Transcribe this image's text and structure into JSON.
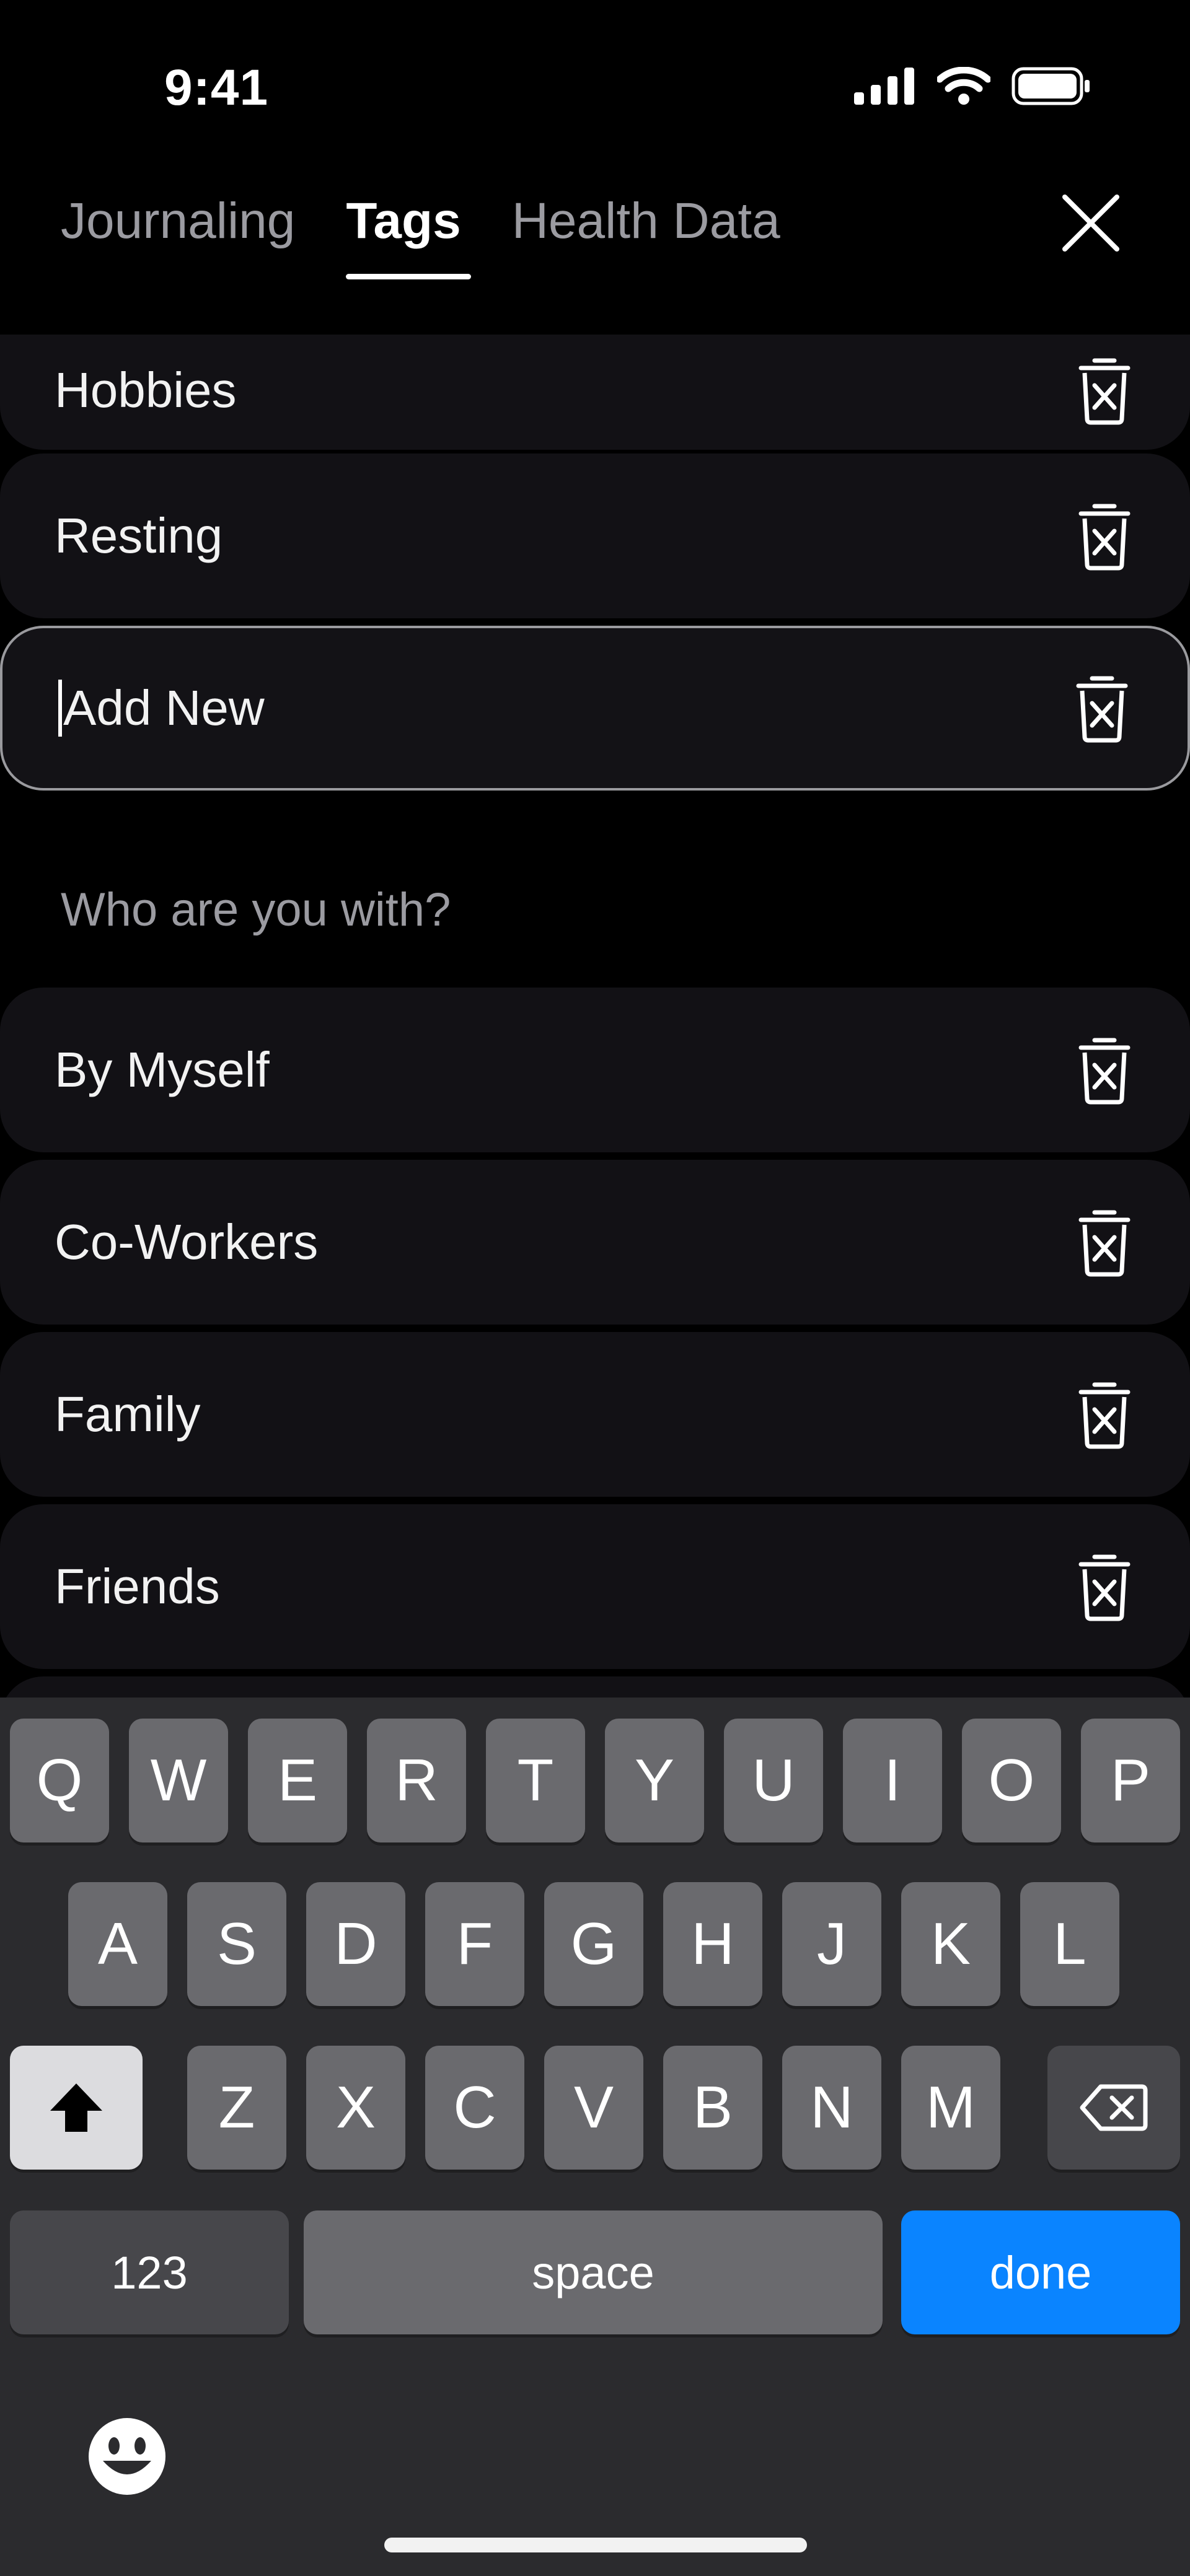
{
  "status_bar": {
    "time": "9:41"
  },
  "tabs": [
    {
      "label": "Journaling",
      "active": false
    },
    {
      "label": "Tags",
      "active": true
    },
    {
      "label": "Health Data",
      "active": false
    }
  ],
  "tags_list": {
    "activity_items": [
      {
        "label": "Hobbies"
      },
      {
        "label": "Resting"
      }
    ],
    "new_tag_input": {
      "value": "Add New"
    },
    "section_with": {
      "title": "Who are you with?",
      "items": [
        {
          "label": "By Myself"
        },
        {
          "label": "Co-Workers"
        },
        {
          "label": "Family"
        },
        {
          "label": "Friends"
        }
      ]
    }
  },
  "keyboard": {
    "row1": [
      "Q",
      "W",
      "E",
      "R",
      "T",
      "Y",
      "U",
      "I",
      "O",
      "P"
    ],
    "row2": [
      "A",
      "S",
      "D",
      "F",
      "G",
      "H",
      "J",
      "K",
      "L"
    ],
    "row3": [
      "Z",
      "X",
      "C",
      "V",
      "B",
      "N",
      "M"
    ],
    "numbers_label": "123",
    "space_label": "space",
    "done_label": "done"
  },
  "colors": {
    "background": "#000000",
    "row_bg": "#121115",
    "muted_text": "#9b9ba1",
    "key_bg": "#6a6a6e",
    "accent_blue": "#0a84ff"
  }
}
